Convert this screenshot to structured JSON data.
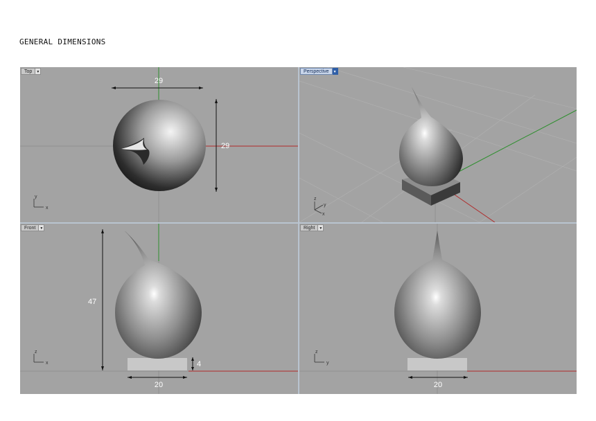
{
  "page": {
    "title": "GENERAL DIMENSIONS"
  },
  "colors": {
    "viewport_bg": "#a3a3a3",
    "x_axis": "#b02a2a",
    "y_axis": "#2f8f2f",
    "dimension_line": "#111111",
    "active_tab": "#2f5fa8"
  },
  "viewports": {
    "top": {
      "label": "Top",
      "menu_icon": "chevron-down-icon",
      "axis_labels": [
        "y",
        "x"
      ],
      "dims": {
        "width": "29",
        "height": "29"
      }
    },
    "perspective": {
      "label": "Perspective",
      "menu_icon": "chevron-down-icon",
      "active": true,
      "axis_labels": [
        "z",
        "y",
        "x"
      ]
    },
    "front": {
      "label": "Front",
      "menu_icon": "chevron-down-icon",
      "axis_labels": [
        "z",
        "x"
      ],
      "dims": {
        "height": "47",
        "base_height": "4",
        "base_width": "20"
      }
    },
    "right": {
      "label": "Right",
      "menu_icon": "chevron-down-icon",
      "axis_labels": [
        "z",
        "y"
      ],
      "dims": {
        "base_width": "20"
      }
    }
  }
}
